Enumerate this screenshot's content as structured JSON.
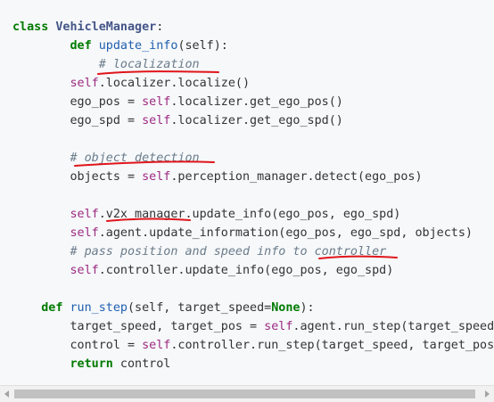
{
  "code": {
    "lines": [
      {
        "id": "l1",
        "tokens": [
          {
            "t": "class ",
            "c": "kw"
          },
          {
            "t": "VehicleManager",
            "c": "cls"
          },
          {
            "t": ":",
            "c": ""
          }
        ]
      },
      {
        "id": "l2",
        "tokens": [
          {
            "t": "        ",
            "c": ""
          },
          {
            "t": "def",
            "c": "kw"
          },
          {
            "t": " ",
            "c": ""
          },
          {
            "t": "update_info",
            "c": "fn"
          },
          {
            "t": "(self):",
            "c": ""
          }
        ]
      },
      {
        "id": "l3",
        "tokens": [
          {
            "t": "            ",
            "c": ""
          },
          {
            "t": "# localization",
            "c": "cm"
          }
        ]
      },
      {
        "id": "l4",
        "tokens": [
          {
            "t": "        ",
            "c": ""
          },
          {
            "t": "self",
            "c": "self"
          },
          {
            "t": ".localizer.localize()",
            "c": ""
          }
        ]
      },
      {
        "id": "l5",
        "tokens": [
          {
            "t": "        ego_pos = ",
            "c": ""
          },
          {
            "t": "self",
            "c": "self"
          },
          {
            "t": ".localizer.get_ego_pos()",
            "c": ""
          }
        ]
      },
      {
        "id": "l6",
        "tokens": [
          {
            "t": "        ego_spd = ",
            "c": ""
          },
          {
            "t": "self",
            "c": "self"
          },
          {
            "t": ".localizer.get_ego_spd()",
            "c": ""
          }
        ]
      },
      {
        "id": "l7",
        "tokens": []
      },
      {
        "id": "l8",
        "tokens": [
          {
            "t": "        ",
            "c": ""
          },
          {
            "t": "# object detection",
            "c": "cm"
          }
        ]
      },
      {
        "id": "l9",
        "tokens": [
          {
            "t": "        objects = ",
            "c": ""
          },
          {
            "t": "self",
            "c": "self"
          },
          {
            "t": ".perception_manager.detect(ego_pos)",
            "c": ""
          }
        ]
      },
      {
        "id": "l10",
        "tokens": []
      },
      {
        "id": "l11",
        "tokens": [
          {
            "t": "        ",
            "c": ""
          },
          {
            "t": "self",
            "c": "self"
          },
          {
            "t": ".v2x_manager.update_info(ego_pos, ego_spd)",
            "c": ""
          }
        ]
      },
      {
        "id": "l12",
        "tokens": [
          {
            "t": "        ",
            "c": ""
          },
          {
            "t": "self",
            "c": "self"
          },
          {
            "t": ".agent.update_information(ego_pos, ego_spd, objects)",
            "c": ""
          }
        ]
      },
      {
        "id": "l13",
        "tokens": [
          {
            "t": "        ",
            "c": ""
          },
          {
            "t": "# pass position and speed info to controller",
            "c": "cm"
          }
        ]
      },
      {
        "id": "l14",
        "tokens": [
          {
            "t": "        ",
            "c": ""
          },
          {
            "t": "self",
            "c": "self"
          },
          {
            "t": ".controller.update_info(ego_pos, ego_spd)",
            "c": ""
          }
        ]
      },
      {
        "id": "l15",
        "tokens": []
      },
      {
        "id": "l16",
        "tokens": [
          {
            "t": "    ",
            "c": ""
          },
          {
            "t": "def",
            "c": "kw"
          },
          {
            "t": " ",
            "c": ""
          },
          {
            "t": "run_step",
            "c": "fn"
          },
          {
            "t": "(self, target_speed=",
            "c": ""
          },
          {
            "t": "None",
            "c": "kw"
          },
          {
            "t": "):",
            "c": ""
          }
        ]
      },
      {
        "id": "l17",
        "tokens": [
          {
            "t": "        target_speed, target_pos = ",
            "c": ""
          },
          {
            "t": "self",
            "c": "self"
          },
          {
            "t": ".agent.run_step(target_speed)",
            "c": ""
          }
        ]
      },
      {
        "id": "l18",
        "tokens": [
          {
            "t": "        control = ",
            "c": ""
          },
          {
            "t": "self",
            "c": "self"
          },
          {
            "t": ".controller.run_step(target_speed, target_pos)",
            "c": ""
          }
        ]
      },
      {
        "id": "l19",
        "tokens": [
          {
            "t": "        ",
            "c": ""
          },
          {
            "t": "return",
            "c": "kw"
          },
          {
            "t": " control",
            "c": ""
          }
        ]
      }
    ]
  },
  "annotations": {
    "underline_color": "#e0151b"
  },
  "scrollbar": {
    "left_icon": "chevron-left-icon",
    "right_icon": "chevron-right-icon"
  }
}
